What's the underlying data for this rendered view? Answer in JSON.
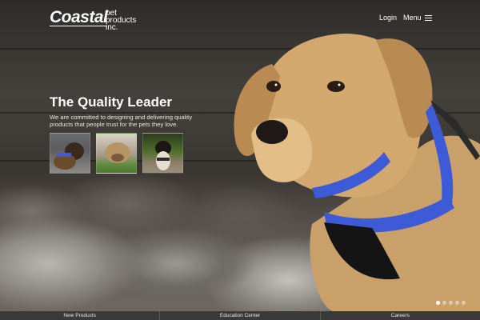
{
  "header": {
    "logo_main": "Coastal",
    "logo_sub_1": "pet",
    "logo_sub_2": "products",
    "logo_sub_3": "inc.",
    "login_label": "Login",
    "menu_label": "Menu"
  },
  "hero": {
    "headline": "The Quality Leader",
    "tagline": "We are committed to designing and delivering quality products that people trust for the pets they love."
  },
  "carousel": {
    "slide_count": 5,
    "active_index": 0
  },
  "footer": {
    "items": [
      {
        "label": "New Products"
      },
      {
        "label": "Education Center"
      },
      {
        "label": "Careers"
      }
    ]
  },
  "colors": {
    "footer_bg": "#3a3a3a",
    "harness_blue": "#3d5bd6",
    "text": "#ffffff"
  }
}
